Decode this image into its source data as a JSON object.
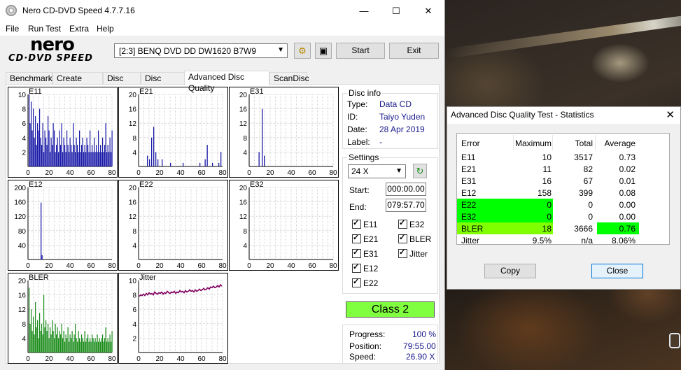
{
  "main_window": {
    "title": "Nero CD-DVD Speed 4.7.7.16",
    "menu": [
      "File",
      "Run Test",
      "Extra",
      "Help"
    ],
    "logo_top": "nero",
    "logo_bottom": "CD·DVD SPEED",
    "drive": "[2:3]   BENQ DVD DD DW1620 B7W9",
    "start_label": "Start",
    "exit_label": "Exit"
  },
  "tabs": [
    "Benchmark",
    "Create Disc",
    "Disc Info",
    "Disc Quality",
    "Advanced Disc Quality",
    "ScanDisc"
  ],
  "active_tab": "Advanced Disc Quality",
  "disc_info": {
    "title": "Disc info",
    "type_label": "Type:",
    "type": "Data CD",
    "id_label": "ID:",
    "id": "Taiyo Yuden",
    "date_label": "Date:",
    "date": "28 Apr 2019",
    "label_label": "Label:",
    "label": "-"
  },
  "settings": {
    "title": "Settings",
    "speed": "24 X",
    "start_label": "Start:",
    "start": "000:00.00",
    "end_label": "End:",
    "end": "079:57.70",
    "checks": [
      "E11",
      "E32",
      "E21",
      "BLER",
      "E31",
      "Jitter",
      "E12",
      "E22"
    ]
  },
  "class_label": "Class 2",
  "progress": {
    "progress_label": "Progress:",
    "progress": "100 %",
    "position_label": "Position:",
    "position": "79:55.00",
    "speed_label": "Speed:",
    "speed": "26.90 X"
  },
  "colors": {
    "chart_blue": "#1a1aa8",
    "chart_green": "#1a8c1a",
    "chart_purple": "#800060",
    "highlight_green": "#00ff00",
    "highlight_lime": "#7fff00",
    "class_green": "#80ff40"
  },
  "chart_data": [
    {
      "type": "bar",
      "title": "E11",
      "ylim": [
        0,
        10
      ],
      "yticks": [
        2,
        4,
        6,
        8,
        10
      ],
      "xticks": [
        0,
        20,
        40,
        60,
        80
      ],
      "series": [
        {
          "values": [
            10,
            6,
            9,
            5,
            8,
            4,
            7,
            3,
            6,
            5,
            8,
            4,
            3,
            6,
            2,
            5,
            4,
            3,
            7,
            5,
            2,
            4,
            3,
            6,
            5,
            2,
            3,
            4,
            2,
            5,
            3,
            6,
            2,
            4,
            3,
            2,
            5,
            3,
            2,
            4,
            3,
            2,
            6,
            3,
            2,
            4,
            3,
            2,
            5,
            2,
            3,
            4,
            2,
            3,
            2,
            4,
            3,
            2,
            5,
            2,
            3,
            2,
            4,
            2,
            3,
            2,
            5,
            2,
            3,
            2,
            4,
            2,
            3,
            6,
            2,
            3,
            2,
            4,
            2,
            5
          ]
        }
      ]
    },
    {
      "type": "bar",
      "title": "E21",
      "ylim": [
        0,
        20
      ],
      "yticks": [
        4,
        8,
        12,
        16,
        20
      ],
      "xticks": [
        0,
        20,
        40,
        60,
        80
      ],
      "series": [
        {
          "values": [
            [
              8,
              3
            ],
            [
              10,
              2
            ],
            [
              12,
              8
            ],
            [
              14,
              11
            ],
            [
              16,
              4
            ],
            [
              18,
              2
            ],
            [
              22,
              2
            ],
            [
              30,
              1
            ],
            [
              42,
              1
            ],
            [
              58,
              1
            ],
            [
              63,
              2
            ],
            [
              65,
              6
            ],
            [
              70,
              1
            ],
            [
              76,
              1
            ],
            [
              78,
              4
            ]
          ]
        }
      ]
    },
    {
      "type": "bar",
      "title": "E31",
      "ylim": [
        0,
        20
      ],
      "yticks": [
        4,
        8,
        12,
        16,
        20
      ],
      "xticks": [
        0,
        20,
        40,
        60,
        80
      ],
      "series": [
        {
          "values": [
            [
              9,
              4
            ],
            [
              12,
              16
            ],
            [
              14,
              3
            ]
          ]
        }
      ]
    },
    {
      "type": "bar",
      "title": "E12",
      "ylim": [
        0,
        200
      ],
      "yticks": [
        40,
        80,
        120,
        160,
        200
      ],
      "xticks": [
        0,
        20,
        40,
        60,
        80
      ],
      "series": [
        {
          "values": [
            [
              12,
              158
            ],
            [
              13,
              12
            ]
          ]
        }
      ]
    },
    {
      "type": "bar",
      "title": "E22",
      "ylim": [
        0,
        20
      ],
      "yticks": [
        4,
        8,
        12,
        16,
        20
      ],
      "xticks": [
        0,
        20,
        40,
        60,
        80
      ],
      "series": [
        {
          "values": []
        }
      ]
    },
    {
      "type": "bar",
      "title": "E32",
      "ylim": [
        0,
        20
      ],
      "yticks": [
        4,
        8,
        12,
        16,
        20
      ],
      "xticks": [
        0,
        20,
        40,
        60,
        80
      ],
      "series": [
        {
          "values": []
        }
      ]
    },
    {
      "type": "bar",
      "title": "BLER",
      "ylim": [
        0,
        20
      ],
      "yticks": [
        4,
        8,
        12,
        16,
        20
      ],
      "xticks": [
        0,
        20,
        40,
        60,
        80
      ],
      "series": [
        {
          "values": [
            18,
            8,
            12,
            6,
            10,
            5,
            14,
            7,
            9,
            4,
            11,
            6,
            8,
            5,
            16,
            7,
            9,
            6,
            8,
            4,
            7,
            5,
            9,
            6,
            4,
            8,
            5,
            7,
            4,
            6,
            5,
            8,
            4,
            6,
            3,
            5,
            4,
            7,
            3,
            5,
            4,
            6,
            3,
            5,
            8,
            4,
            3,
            6,
            4,
            3,
            5,
            4,
            3,
            6,
            3,
            4,
            5,
            3,
            4,
            3,
            5,
            4,
            3,
            4,
            3,
            5,
            3,
            4,
            3,
            4,
            5,
            3,
            4,
            7,
            3,
            4,
            3,
            5,
            3,
            6
          ]
        }
      ]
    },
    {
      "type": "line",
      "title": "Jitter",
      "ylim": [
        0,
        10
      ],
      "yticks": [
        2,
        4,
        6,
        8,
        10
      ],
      "xticks": [
        0,
        20,
        40,
        60,
        80
      ],
      "series": [
        {
          "values": [
            7.8,
            8.0,
            7.9,
            8.1,
            7.9,
            8.2,
            8.0,
            8.3,
            8.1,
            8.2,
            8.0,
            8.4,
            8.2,
            8.1,
            8.3,
            8.2,
            8.4,
            8.1,
            8.3,
            8.2,
            8.5,
            8.3,
            8.2,
            8.4,
            8.3,
            8.5,
            8.2,
            8.4,
            8.3,
            8.6,
            8.4,
            8.5,
            8.3,
            8.6,
            8.4,
            8.5,
            8.7,
            8.5,
            8.6,
            8.4,
            8.7,
            8.5,
            8.6,
            8.8,
            8.6,
            8.7,
            8.9,
            8.7,
            8.8,
            9.0,
            8.8,
            9.1,
            9.0,
            9.2,
            9.0,
            9.1,
            9.3,
            9.1,
            9.4,
            9.2
          ]
        }
      ]
    }
  ],
  "stats_dialog": {
    "title": "Advanced Disc Quality Test - Statistics",
    "headers": [
      "Error",
      "Maximum",
      "Total",
      "Average"
    ],
    "rows": [
      [
        "E11",
        "10",
        "3517",
        "0.73"
      ],
      [
        "E21",
        "11",
        "82",
        "0.02"
      ],
      [
        "E31",
        "16",
        "67",
        "0.01"
      ],
      [
        "E12",
        "158",
        "399",
        "0.08"
      ],
      [
        "E22",
        "0",
        "0",
        "0.00"
      ],
      [
        "E32",
        "0",
        "0",
        "0.00"
      ],
      [
        "BLER",
        "18",
        "3666",
        "0.76"
      ],
      [
        "Jitter",
        "9.5%",
        "n/a",
        "8.06%"
      ]
    ],
    "copy_label": "Copy",
    "close_label": "Close"
  }
}
